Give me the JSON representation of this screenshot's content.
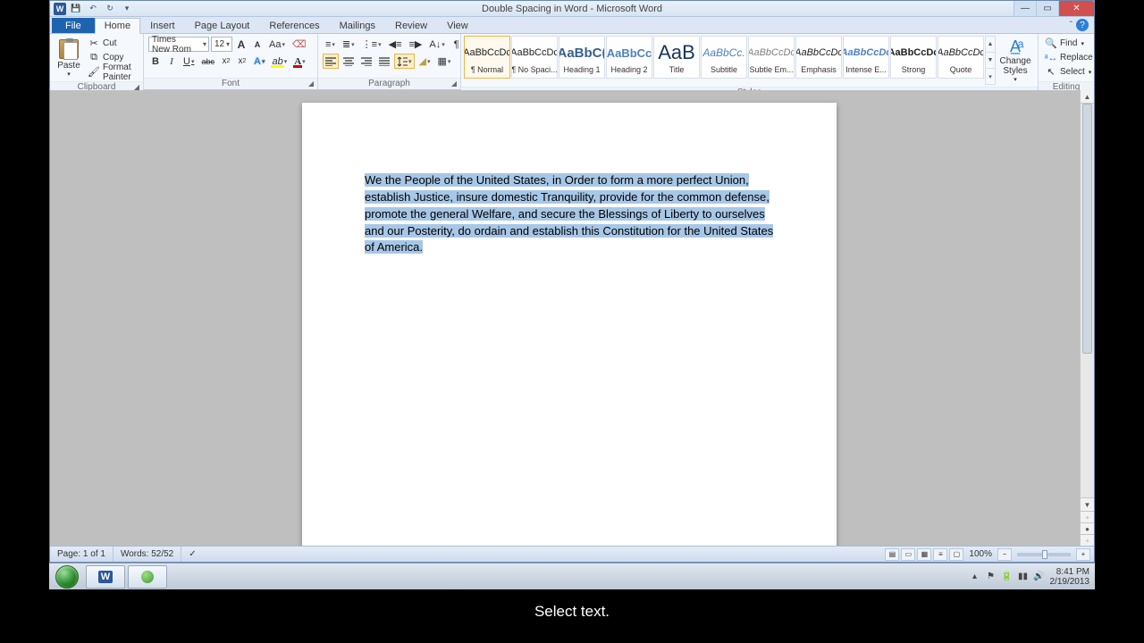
{
  "titlebar": {
    "title": "Double Spacing in Word - Microsoft Word",
    "qat": {
      "save": "💾",
      "undo": "↶",
      "redo": "↻"
    }
  },
  "window_buttons": {
    "min": "—",
    "max": "▭",
    "close": "✕"
  },
  "tabs": {
    "file": "File",
    "items": [
      "Home",
      "Insert",
      "Page Layout",
      "References",
      "Mailings",
      "Review",
      "View"
    ],
    "active": "Home",
    "help": "?"
  },
  "ribbon": {
    "clipboard": {
      "label": "Clipboard",
      "paste": "Paste",
      "cut": "Cut",
      "copy": "Copy",
      "format_painter": "Format Painter"
    },
    "font": {
      "label": "Font",
      "name": "Times New Rom",
      "size": "12",
      "grow": "A",
      "shrink": "A",
      "change_case": "Aa",
      "clear_fmt": "⌫",
      "bold": "B",
      "italic": "I",
      "underline": "U",
      "strike": "abc",
      "sub": "x₂",
      "sup": "x²",
      "effects": "A",
      "highlight": "ab",
      "color": "A"
    },
    "paragraph": {
      "label": "Paragraph"
    },
    "styles": {
      "label": "Styles",
      "items": [
        {
          "preview": "AaBbCcDc",
          "name": "¶ Normal",
          "sel": true,
          "prevStyle": "font-size:11px"
        },
        {
          "preview": "AaBbCcDc",
          "name": "¶ No Spaci...",
          "prevStyle": "font-size:11px"
        },
        {
          "preview": "AaBbC(",
          "name": "Heading 1",
          "prevStyle": "font-size:15px;color:#365f91;font-weight:bold"
        },
        {
          "preview": "AaBbCc",
          "name": "Heading 2",
          "prevStyle": "font-size:13px;color:#4f81bd;font-weight:bold"
        },
        {
          "preview": "AaB",
          "name": "Title",
          "prevStyle": "font-size:22px;color:#17365d"
        },
        {
          "preview": "AaBbCc.",
          "name": "Subtitle",
          "prevStyle": "font-size:12px;font-style:italic;color:#4f81bd"
        },
        {
          "preview": "AaBbCcDc",
          "name": "Subtle Em...",
          "prevStyle": "font-size:11px;font-style:italic;color:#808080"
        },
        {
          "preview": "AaBbCcDc",
          "name": "Emphasis",
          "prevStyle": "font-size:11px;font-style:italic"
        },
        {
          "preview": "AaBbCcDc",
          "name": "Intense E...",
          "prevStyle": "font-size:11px;font-style:italic;font-weight:bold;color:#4f81bd"
        },
        {
          "preview": "AaBbCcDc",
          "name": "Strong",
          "prevStyle": "font-size:11px;font-weight:bold"
        },
        {
          "preview": "AaBbCcDc",
          "name": "Quote",
          "prevStyle": "font-size:11px;font-style:italic"
        }
      ],
      "change_styles": "Change Styles"
    },
    "editing": {
      "label": "Editing",
      "find": "Find",
      "replace": "Replace",
      "select": "Select"
    }
  },
  "document": {
    "text": "We the People of the United States, in Order to form a more perfect Union, establish Justice, insure domestic Tranquility, provide for the common defense, promote the general Welfare, and secure the Blessings of Liberty to ourselves and our Posterity, do ordain and establish this Constitution for the United States of America."
  },
  "statusbar": {
    "page": "Page: 1 of 1",
    "words": "Words: 52/52",
    "zoom_pct": "100%"
  },
  "taskbar": {
    "time": "8:41 PM",
    "date": "2/19/2013"
  },
  "caption": "Select text."
}
